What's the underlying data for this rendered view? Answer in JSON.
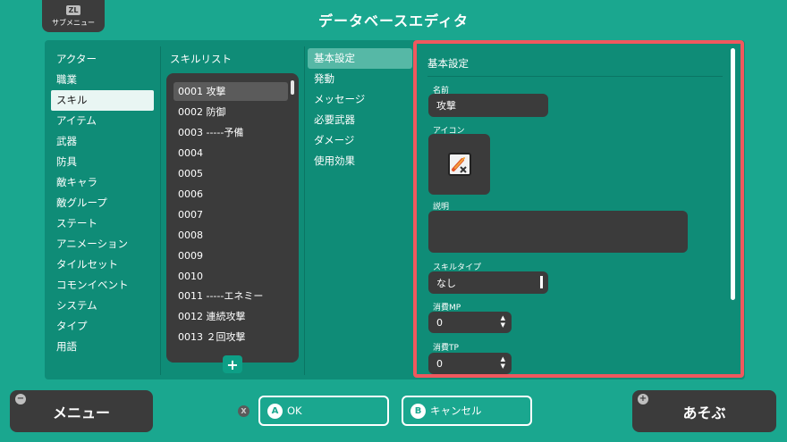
{
  "header": {
    "zl_badge": "ZL",
    "submenu_label": "サブメニュー",
    "title": "データベースエディタ"
  },
  "categories": [
    "アクター",
    "職業",
    "スキル",
    "アイテム",
    "武器",
    "防具",
    "敵キャラ",
    "敵グループ",
    "ステート",
    "アニメーション",
    "タイルセット",
    "コモンイベント",
    "システム",
    "タイプ",
    "用語"
  ],
  "selected_category": "スキル",
  "skill_list": {
    "header": "スキルリスト",
    "items": [
      "0001 攻撃",
      "0002 防御",
      "0003 -----予備",
      "0004",
      "0005",
      "0006",
      "0007",
      "0008",
      "0009",
      "0010",
      "0011 -----エネミー",
      "0012 連続攻撃",
      "0013 ２回攻撃"
    ],
    "selected": "0001 攻撃",
    "add_label": "+"
  },
  "tabs": [
    "基本設定",
    "発動",
    "メッセージ",
    "必要武器",
    "ダメージ",
    "使用効果"
  ],
  "selected_tab": "基本設定",
  "detail": {
    "title": "基本設定",
    "name_label": "名前",
    "name_value": "攻撃",
    "icon_label": "アイコン",
    "icon_name": "sword-slash-icon",
    "description_label": "説明",
    "description_value": "",
    "skill_type_label": "スキルタイプ",
    "skill_type_value": "なし",
    "mp_label": "消費MP",
    "mp_value": "0",
    "tp_label": "消費TP",
    "tp_value": "0"
  },
  "footer": {
    "menu_label": "メニュー",
    "x_badge": "X",
    "ok_badge": "A",
    "ok_label": "OK",
    "cancel_badge": "B",
    "cancel_label": "キャンセル",
    "play_label": "あそぶ",
    "minus_glyph": "−",
    "plus_glyph": "+"
  },
  "colors": {
    "background": "#1aa78f",
    "panel": "#0f8c77",
    "field": "#3b3b3b",
    "highlight_border": "#f0585e"
  }
}
